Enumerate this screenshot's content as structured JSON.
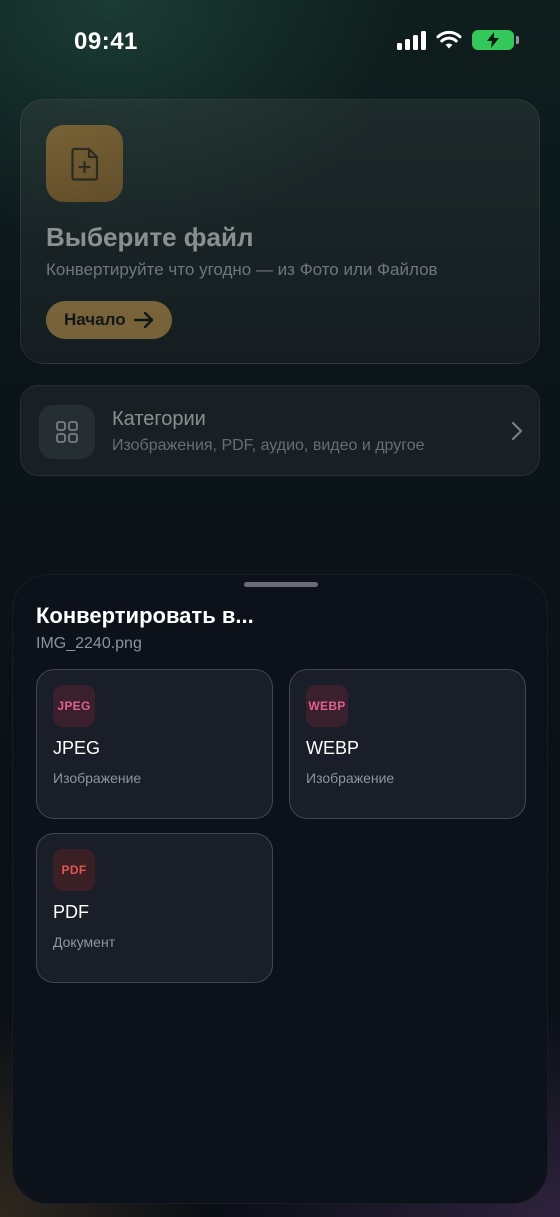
{
  "status_bar": {
    "time": "09:41"
  },
  "hero_card": {
    "title": "Выберите файл",
    "subtitle": "Конвертируйте что угодно — из Фото или Файлов",
    "start_label": "Начало"
  },
  "categories_card": {
    "title": "Категории",
    "subtitle": "Изображения, PDF, аудио, видео и другое"
  },
  "sheet": {
    "title": "Конвертировать в...",
    "file_name": "IMG_2240.png",
    "formats": [
      {
        "badge": "JPEG",
        "name": "JPEG",
        "kind": "Изображение",
        "badge_color": "#e0608f",
        "badge_bg": "#3a1f2c"
      },
      {
        "badge": "WEBP",
        "name": "WEBP",
        "kind": "Изображение",
        "badge_color": "#e0608f",
        "badge_bg": "#3a1f2c"
      },
      {
        "badge": "PDF",
        "name": "PDF",
        "kind": "Документ",
        "badge_color": "#e0574f",
        "badge_bg": "#3a2024"
      }
    ]
  },
  "colors": {
    "accent": "#c99a4e",
    "battery": "#34c759"
  }
}
